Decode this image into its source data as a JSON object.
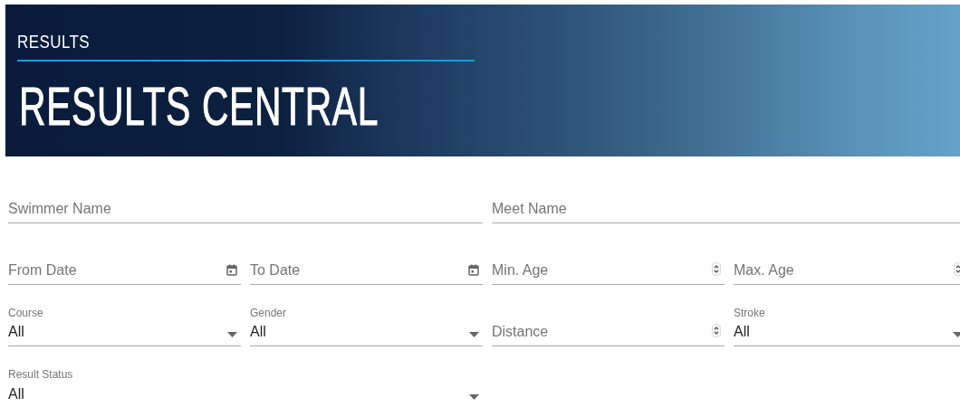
{
  "banner": {
    "eyebrow": "RESULTS",
    "title": "RESULTS CENTRAL"
  },
  "rows": [
    {
      "fields": [
        {
          "kind": "text",
          "placeholder": "Swimmer Name"
        },
        {
          "kind": "text",
          "placeholder": "Meet Name"
        }
      ]
    },
    {
      "fields": [
        {
          "kind": "date",
          "placeholder": "From Date"
        },
        {
          "kind": "date",
          "placeholder": "To Date"
        },
        {
          "kind": "number",
          "placeholder": "Min. Age"
        },
        {
          "kind": "number",
          "placeholder": "Max. Age"
        }
      ]
    },
    {
      "fields": [
        {
          "kind": "select",
          "label": "Course",
          "value": "All"
        },
        {
          "kind": "select",
          "label": "Gender",
          "value": "All"
        },
        {
          "kind": "number",
          "placeholder": "Distance"
        },
        {
          "kind": "select",
          "label": "Stroke",
          "value": "All"
        }
      ]
    },
    {
      "fields": [
        {
          "kind": "select",
          "label": "Result Status",
          "value": "All"
        }
      ]
    }
  ]
}
